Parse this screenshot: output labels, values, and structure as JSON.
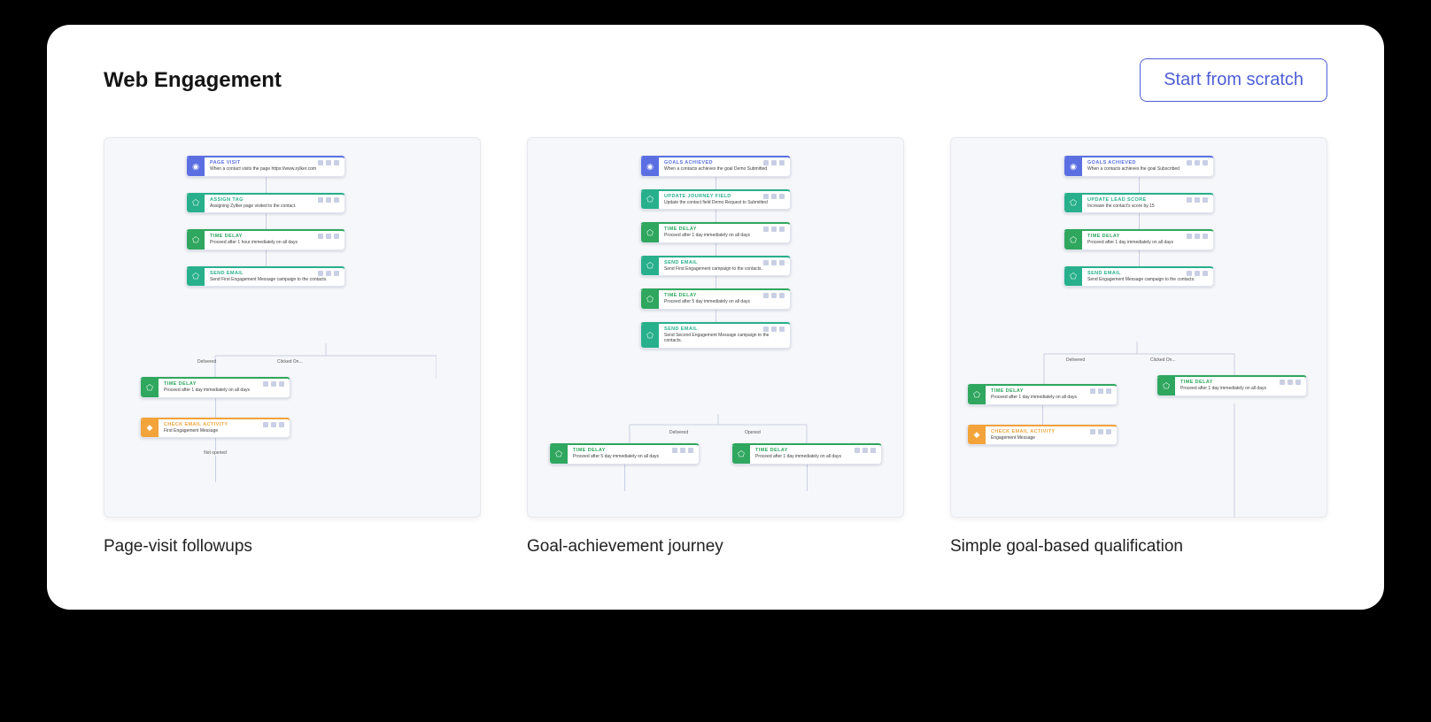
{
  "header": {
    "title": "Web Engagement",
    "start_button": "Start from scratch"
  },
  "cards": [
    {
      "title": "Page-visit followups"
    },
    {
      "title": "Goal-achievement journey"
    },
    {
      "title": "Simple goal-based qualification"
    }
  ],
  "wf1": {
    "n1": {
      "name": "PAGE VISIT",
      "desc": "When a contact visits the page https://www.zylker.com"
    },
    "n2": {
      "name": "ASSIGN TAG",
      "desc": "Assigning Zylker page visited to the contact."
    },
    "n3": {
      "name": "TIME DELAY",
      "desc": "Proceed after 1 hour immediately on all days"
    },
    "n4": {
      "name": "SEND EMAIL",
      "desc": "Send First Engagement Message campaign to the contacts."
    },
    "b": {
      "left": "Delivered",
      "right": "Clicked On..."
    },
    "n5": {
      "name": "TIME DELAY",
      "desc": "Proceed after 1 day immediately on all days"
    },
    "n6": {
      "name": "CHECK EMAIL ACTIVITY",
      "desc": "First Engagement Message"
    },
    "b2": "Not opened"
  },
  "wf2": {
    "n1": {
      "name": "GOALS ACHIEVED",
      "desc": "When a contacts achieves the goal Demo Submitted"
    },
    "n2": {
      "name": "UPDATE JOURNEY FIELD",
      "desc": "Update the contact field Demo Request to Submitted"
    },
    "n3": {
      "name": "TIME DELAY",
      "desc": "Proceed after 1 day immediately on all days"
    },
    "n4": {
      "name": "SEND EMAIL",
      "desc": "Send First Engagement campaign to the contacts."
    },
    "n5": {
      "name": "TIME DELAY",
      "desc": "Proceed after 5 day immediately on all days"
    },
    "n6": {
      "name": "SEND EMAIL",
      "desc": "Send Second Engagement Message campaign to the contacts."
    },
    "b": {
      "left": "Delivered",
      "right": "Opened"
    },
    "n7": {
      "name": "TIME DELAY",
      "desc": "Proceed after 5 day immediately on all days"
    },
    "n8": {
      "name": "TIME DELAY",
      "desc": "Proceed after 1 day immediately on all days"
    }
  },
  "wf3": {
    "n1": {
      "name": "GOALS ACHIEVED",
      "desc": "When a contacts achieves the goal Subscribed"
    },
    "n2": {
      "name": "UPDATE LEAD SCORE",
      "desc": "Increase the contact's score by 15"
    },
    "n3": {
      "name": "TIME DELAY",
      "desc": "Proceed after 1 day immediately on all days"
    },
    "n4": {
      "name": "SEND EMAIL",
      "desc": "Send Engagement Message campaign to the contacts."
    },
    "b": {
      "left": "Delivered",
      "right": "Clicked On..."
    },
    "n5": {
      "name": "TIME DELAY",
      "desc": "Proceed after 1 day immediately on all days"
    },
    "n6": {
      "name": "TIME DELAY",
      "desc": "Proceed after 1 day immediately on all days"
    },
    "n7": {
      "name": "CHECK EMAIL ACTIVITY",
      "desc": "Engagement Message"
    }
  }
}
